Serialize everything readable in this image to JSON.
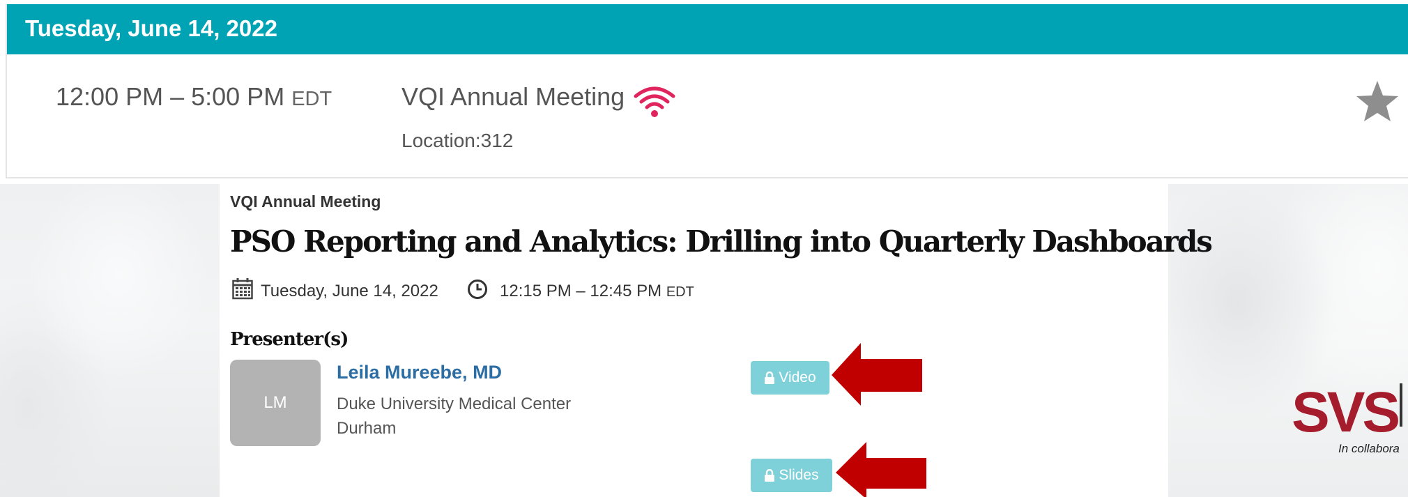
{
  "schedule": {
    "day_header": "Tuesday, June 14, 2022",
    "session": {
      "time": "12:00 PM – 5:00 PM",
      "timezone": "EDT",
      "title": "VQI Annual Meeting",
      "location": "Location:312",
      "live_icon": "wifi-icon",
      "favorite_icon": "star-icon"
    }
  },
  "detail": {
    "event_name": "VQI Annual Meeting",
    "session_title": "PSO Reporting and Analytics: Drilling into Quarterly Dashboards",
    "date": "Tuesday, June 14, 2022",
    "time": "12:15 PM – 12:45 PM",
    "timezone": "EDT",
    "presenters_heading": "Presenter(s)",
    "presenter": {
      "initials": "LM",
      "name": "Leila Mureebe, MD",
      "organization": "Duke University Medical Center",
      "city": "Durham"
    },
    "buttons": {
      "video": "Video",
      "slides": "Slides"
    }
  },
  "branding": {
    "logo_text": "SVS",
    "tagline": "In collabora"
  },
  "colors": {
    "header_teal": "#00a3b4",
    "button_teal": "#7fd1d9",
    "arrow_red": "#c00000",
    "logo_red": "#a51c2c",
    "wifi_pink": "#e0245e",
    "link_blue": "#2c6ea3"
  }
}
